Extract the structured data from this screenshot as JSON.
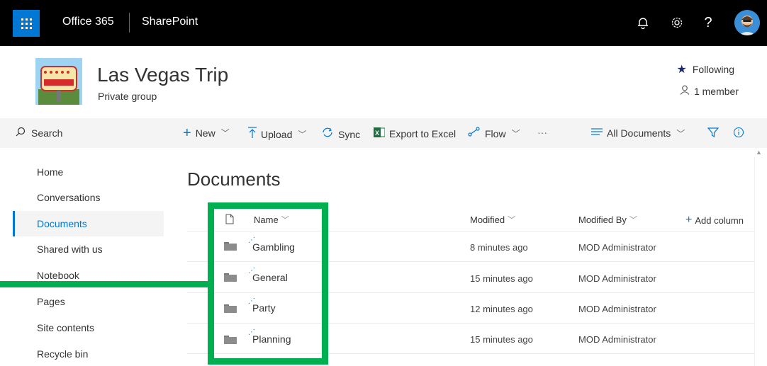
{
  "suite": {
    "brand": "Office 365",
    "app": "SharePoint",
    "icons": [
      "waffle-icon",
      "bell-icon",
      "gear-icon",
      "help-icon",
      "avatar"
    ]
  },
  "site": {
    "title": "Las Vegas Trip",
    "subtitle": "Private group",
    "following_label": "Following",
    "members_label": "1 member"
  },
  "search": {
    "label": "Search"
  },
  "commands": {
    "new": "New",
    "upload": "Upload",
    "sync": "Sync",
    "export": "Export to Excel",
    "flow": "Flow",
    "more": "···",
    "view": "All Documents"
  },
  "nav": {
    "items": [
      {
        "label": "Home"
      },
      {
        "label": "Conversations"
      },
      {
        "label": "Documents",
        "active": true
      },
      {
        "label": "Shared with us"
      },
      {
        "label": "Notebook"
      },
      {
        "label": "Pages"
      },
      {
        "label": "Site contents"
      },
      {
        "label": "Recycle bin"
      }
    ]
  },
  "library": {
    "title": "Documents",
    "columns": {
      "name": "Name",
      "modified": "Modified",
      "modified_by": "Modified By",
      "add_column": "Add column"
    },
    "rows": [
      {
        "name": "Gambling",
        "modified": "8 minutes ago",
        "modified_by": "MOD Administrator"
      },
      {
        "name": "General",
        "modified": "15 minutes ago",
        "modified_by": "MOD Administrator"
      },
      {
        "name": "Party",
        "modified": "12 minutes ago",
        "modified_by": "MOD Administrator"
      },
      {
        "name": "Planning",
        "modified": "15 minutes ago",
        "modified_by": "MOD Administrator"
      }
    ]
  },
  "colors": {
    "accent": "#0078d4",
    "suite_bar": "#000000",
    "highlight": "#00b050"
  }
}
